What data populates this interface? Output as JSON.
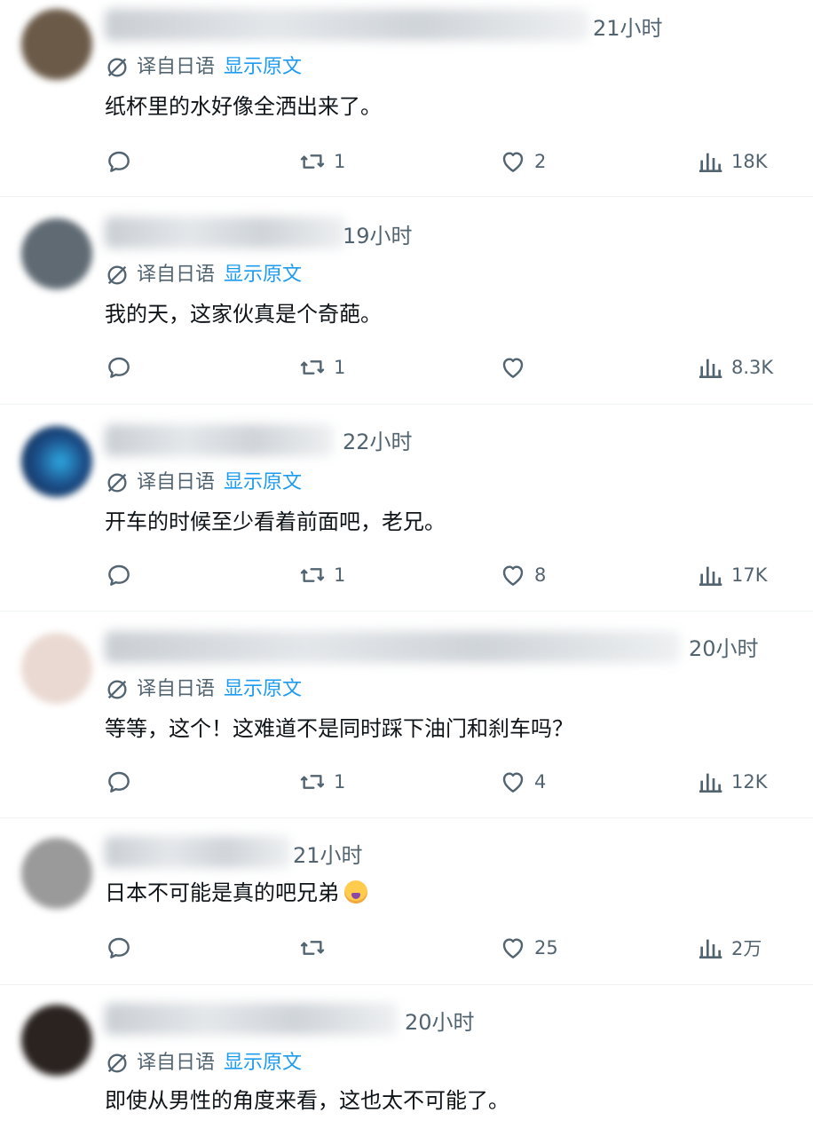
{
  "replies": [
    {
      "time": "21小时",
      "translate_label": "译自日语",
      "show_original": "显示原文",
      "text": "纸杯里的水好像全洒出来了。",
      "reposts": "1",
      "likes": "2",
      "views": "18K",
      "avatar_color": "#6b5a48"
    },
    {
      "time": "19小时",
      "translate_label": "译自日语",
      "show_original": "显示原文",
      "text": "我的天，这家伙真是个奇葩。",
      "reposts": "1",
      "likes": "",
      "views": "8.3K",
      "avatar_color": "#5f6a73"
    },
    {
      "time": "22小时",
      "translate_label": "译自日语",
      "show_original": "显示原文",
      "text": "开车的时候至少看着前面吧，老兄。",
      "reposts": "1",
      "likes": "8",
      "views": "17K",
      "avatar_color": "#1c4f8a"
    },
    {
      "time": "20小时",
      "translate_label": "译自日语",
      "show_original": "显示原文",
      "text": "等等，这个！这难道不是同时踩下油门和刹车吗？",
      "reposts": "1",
      "likes": "4",
      "views": "12K",
      "avatar_color": "#d9c7bf"
    },
    {
      "time": "21小时",
      "text": "日本不可能是真的吧兄弟",
      "reposts": "",
      "likes": "25",
      "views": "2万",
      "avatar_color": "#8c8c8c"
    },
    {
      "time": "20小时",
      "translate_label": "译自日语",
      "show_original": "显示原文",
      "text": "即使从男性的角度来看，这也太不可能了。",
      "avatar_color": "#2a2320"
    }
  ],
  "icons": {
    "reply": "reply-icon",
    "repost": "repost-icon",
    "like": "heart-icon",
    "views": "views-icon",
    "translate": "translate-icon",
    "emoji": "crying-face-emoji"
  },
  "colors": {
    "secondary_text": "#536471",
    "link": "#1d9bf0",
    "divider": "#eff3f4"
  }
}
